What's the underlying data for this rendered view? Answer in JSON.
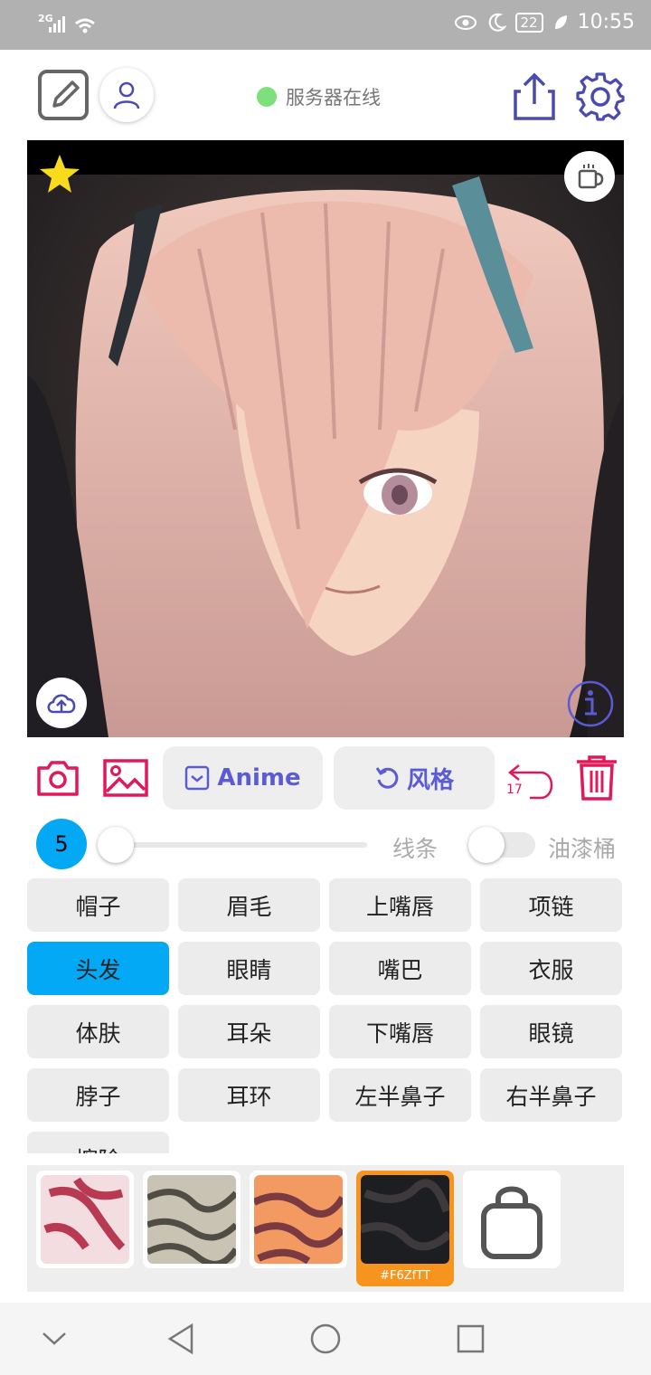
{
  "status_bar": {
    "network": "2G",
    "battery": "22",
    "time": "10:55"
  },
  "toolbar": {
    "server_status": "服务器在线",
    "server_status_color": "#7ee07a"
  },
  "actions": {
    "anime_label": "Anime",
    "style_label": "风格",
    "undo_count": "17"
  },
  "brush": {
    "size": "5",
    "size_fraction": 0.0,
    "line_label": "线条",
    "bucket_label": "油漆桶",
    "bucket_enabled": false
  },
  "parts": [
    {
      "label": "帽子"
    },
    {
      "label": "眉毛"
    },
    {
      "label": "上嘴唇"
    },
    {
      "label": "项链"
    },
    {
      "label": "头发"
    },
    {
      "label": "眼睛"
    },
    {
      "label": "嘴巴"
    },
    {
      "label": "衣服"
    },
    {
      "label": "体肤"
    },
    {
      "label": "耳朵"
    },
    {
      "label": "下嘴唇"
    },
    {
      "label": "眼镜"
    },
    {
      "label": "脖子"
    },
    {
      "label": "耳环"
    },
    {
      "label": "左半鼻子"
    },
    {
      "label": "右半鼻子"
    },
    {
      "label": "擦除"
    }
  ],
  "active_part": "头发",
  "swatches": {
    "selected_code": "#F6ZfTT"
  },
  "colors": {
    "accent_pink": "#e0195a",
    "accent_purple": "#5b5bd6",
    "selected_blue": "#03a9f4",
    "swatch_orange": "#f7941d"
  }
}
